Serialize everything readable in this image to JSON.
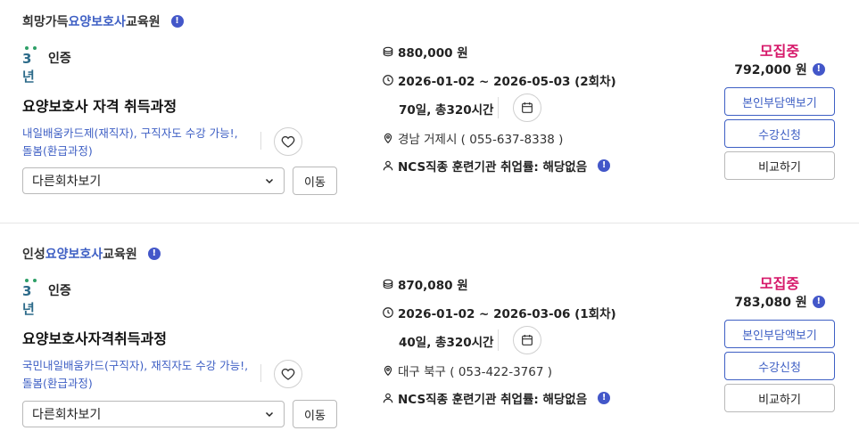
{
  "courses": [
    {
      "institution_prefix": "희망가득",
      "institution_highlight": "요양보호사",
      "institution_suffix": "교육원",
      "info_mark": "!",
      "cert_logo_text": "3년",
      "cert_label": "인증",
      "title": "요양보호사 자격 취득과정",
      "tags": [
        "내일배움카드제(재직자),",
        "구직자도 수강 가능!,",
        "돌봄(환급과정)"
      ],
      "session_select": "다른회차보기",
      "move_button": "이동",
      "price": "880,000 원",
      "dates": "2026-01-02 ~ 2026-05-03 (2회차)",
      "duration": "70일, 총320시간",
      "location": "경남 거제시 ( 055-637-8338 )",
      "employment": "NCS직종 훈련기관 취업률: 해당없음",
      "status": "모집중",
      "self_fee": "792,000 원",
      "buttons": [
        "본인부담액보기",
        "수강신청",
        "비교하기"
      ]
    },
    {
      "institution_prefix": "인성",
      "institution_highlight": "요양보호사",
      "institution_suffix": "교육원",
      "info_mark": "!",
      "cert_logo_text": "3년",
      "cert_label": "인증",
      "title": "요양보호사자격취득과정",
      "tags": [
        "국민내일배움카드(구직자),",
        "재직자도 수강 가능!,",
        "돌봄(환급과정)"
      ],
      "session_select": "다른회차보기",
      "move_button": "이동",
      "price": "870,080 원",
      "dates": "2026-01-02 ~ 2026-03-06 (1회차)",
      "duration": "40일, 총320시간",
      "location": "대구 북구 ( 053-422-3767 )",
      "employment": "NCS직종 훈련기관 취업률: 해당없음",
      "status": "모집중",
      "self_fee": "783,080 원",
      "buttons": [
        "본인부담액보기",
        "수강신청",
        "비교하기"
      ]
    }
  ],
  "colors": {
    "accent": "#3e5fc4",
    "status": "#d6186a",
    "cert_green": "#2e9f67"
  }
}
